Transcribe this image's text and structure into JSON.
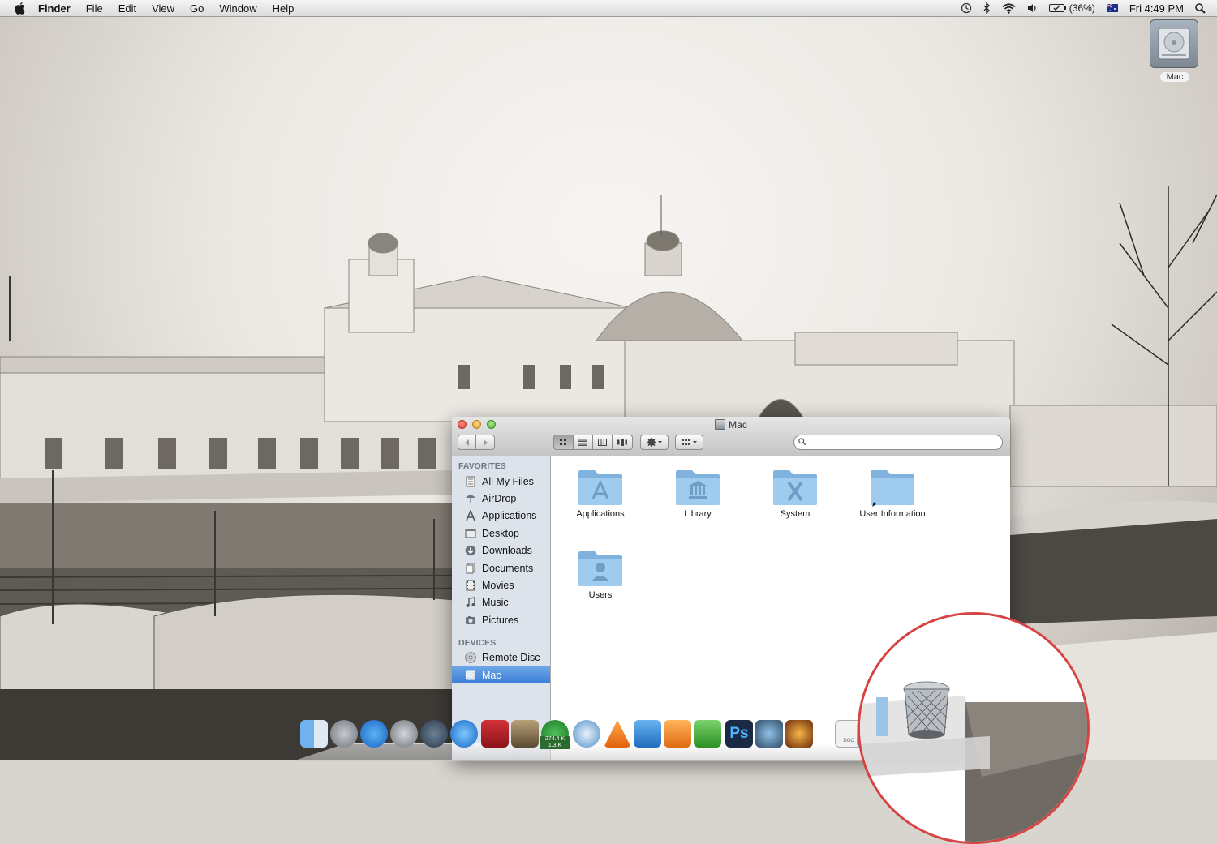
{
  "menubar": {
    "app_name": "Finder",
    "menus": [
      "File",
      "Edit",
      "View",
      "Go",
      "Window",
      "Help"
    ],
    "battery": "(36%)",
    "clock": "Fri 4:49 PM"
  },
  "desktop": {
    "disk_label": "Mac"
  },
  "window": {
    "title": "Mac",
    "search_placeholder": "",
    "sidebar": {
      "favorites_header": "FAVORITES",
      "favorites": [
        {
          "label": "All My Files",
          "icon": "all-files-icon"
        },
        {
          "label": "AirDrop",
          "icon": "airdrop-icon"
        },
        {
          "label": "Applications",
          "icon": "applications-icon"
        },
        {
          "label": "Desktop",
          "icon": "desktop-icon"
        },
        {
          "label": "Downloads",
          "icon": "downloads-icon"
        },
        {
          "label": "Documents",
          "icon": "documents-icon"
        },
        {
          "label": "Movies",
          "icon": "movies-icon"
        },
        {
          "label": "Music",
          "icon": "music-icon"
        },
        {
          "label": "Pictures",
          "icon": "pictures-icon"
        }
      ],
      "devices_header": "DEVICES",
      "devices": [
        {
          "label": "Remote Disc",
          "icon": "remote-disc-icon"
        },
        {
          "label": "Mac",
          "icon": "disk-icon",
          "selected": true
        }
      ]
    },
    "items": [
      {
        "label": "Applications",
        "emblem": "applications-emblem"
      },
      {
        "label": "Library",
        "emblem": "library-emblem"
      },
      {
        "label": "System",
        "emblem": "system-x-emblem"
      },
      {
        "label": "User Information",
        "emblem": "alias-arrow"
      },
      {
        "label": "Users",
        "emblem": "users-emblem"
      }
    ]
  },
  "dock": {
    "badge_top": "274.4 K",
    "badge_bottom": "1.3 K",
    "doc_label": "DOC"
  },
  "colors": {
    "selection": "#3a7fd6",
    "sidebar_bg": "#dde3ea",
    "folder_blue": "#8fbfe6",
    "zoom_ring": "#d74343"
  }
}
